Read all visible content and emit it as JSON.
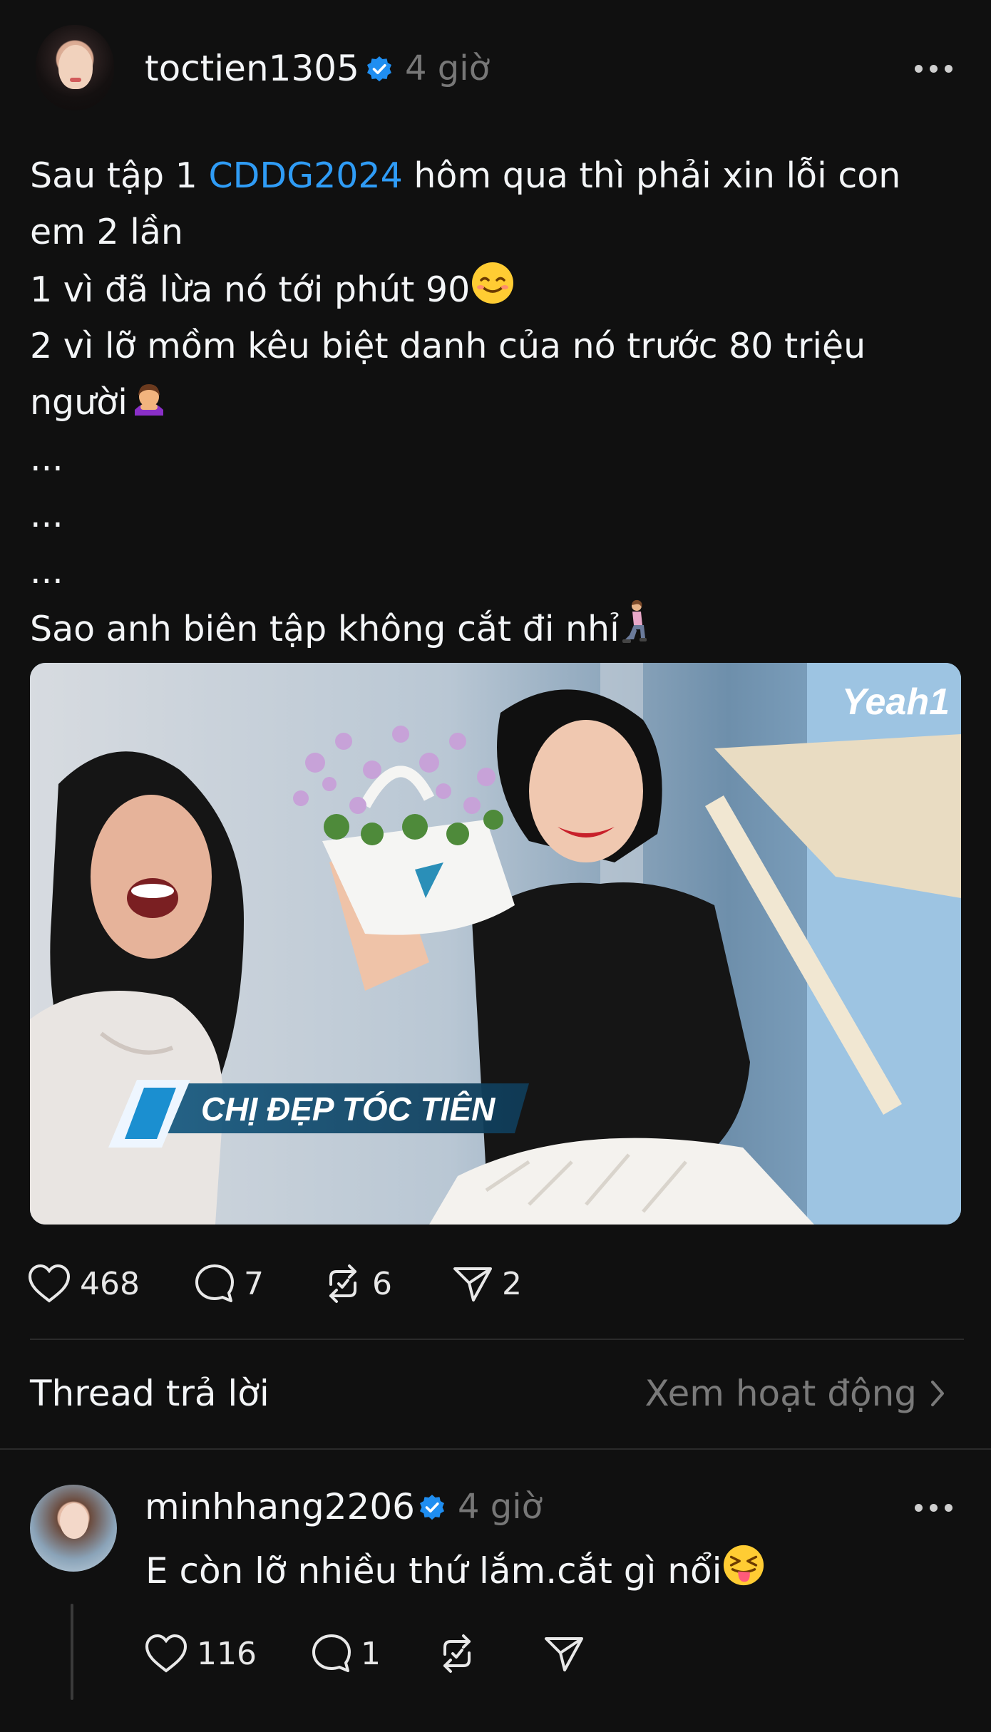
{
  "post": {
    "author": {
      "username": "toctien1305",
      "verified": true,
      "time": "4 giờ"
    },
    "text": {
      "line1_before": "Sau tập 1 ",
      "line1_tag": "CDDG2024",
      "line1_after": " hôm qua thì phải xin lỗi con",
      "line2": "em 2 lần",
      "line3": "1 vì đã lừa nó tới phút 90",
      "line4": "2 vì lỡ mồm kêu biệt danh của nó trước 80 triệu",
      "line5": "người",
      "line6": "...",
      "line7": "...",
      "line8": "...",
      "line9": "Sao anh biên tập không cắt đi nhỉ"
    },
    "media": {
      "watermark": "Yeah1",
      "caption": "CHỊ ĐẸP TÓC TIÊN"
    },
    "stats": {
      "likes": "468",
      "comments": "7",
      "reposts": "6",
      "shares": "2"
    }
  },
  "replies_section": {
    "label": "Thread trả lời",
    "activity_link": "Xem hoạt động"
  },
  "reply": {
    "author": {
      "username": "minhhang2206",
      "verified": true,
      "time": "4 giờ"
    },
    "text": "E còn lỡ nhiều thứ lắm.cắt gì nổi",
    "stats": {
      "likes": "116",
      "comments": "1"
    }
  },
  "icons": {
    "like": "heart-icon",
    "comment": "speech-bubble-icon",
    "repost": "repost-icon",
    "share": "send-icon",
    "verified": "verified-badge-icon",
    "more": "more-dots-icon"
  },
  "colors": {
    "background": "#101010",
    "text": "#f3f5f7",
    "secondary": "#777777",
    "link": "#2f9cf6",
    "verified": "#1f8ef1"
  }
}
